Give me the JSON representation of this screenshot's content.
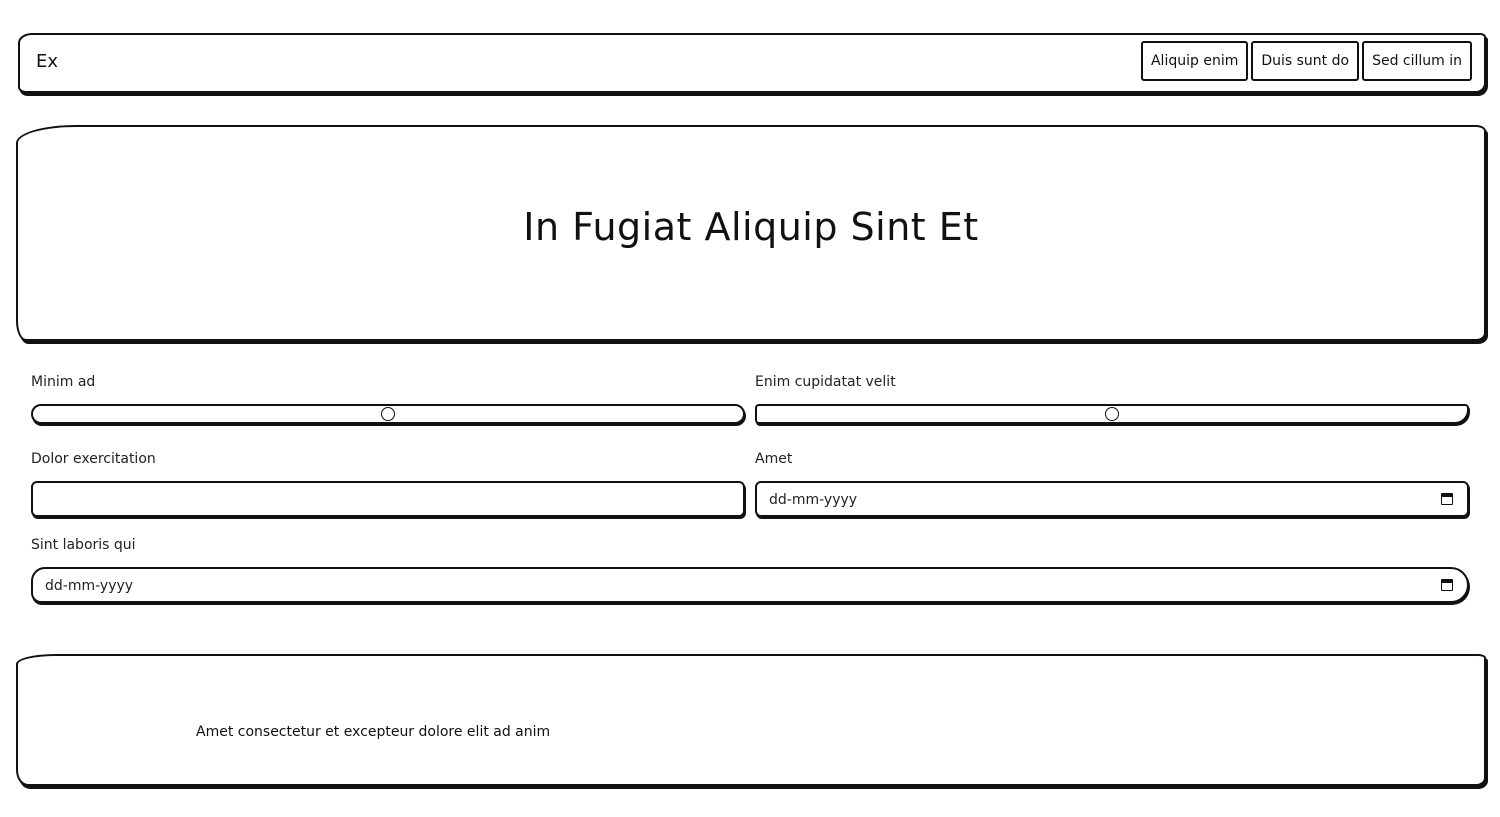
{
  "navbar": {
    "brand": "Ex",
    "links": [
      "Aliquip enim",
      "Duis sunt do",
      "Sed cillum in"
    ]
  },
  "hero": {
    "title": "In Fugiat Aliquip Sint Et"
  },
  "form": {
    "range1": {
      "label": "Minim ad",
      "value_fraction": 0.5
    },
    "range2": {
      "label": "Enim cupidatat velit",
      "value_fraction": 0.5
    },
    "text1": {
      "label": "Dolor exercitation",
      "value": ""
    },
    "date1": {
      "label": "Amet",
      "placeholder": "dd-mm-yyyy"
    },
    "date2": {
      "label": "Sint laboris qui",
      "placeholder": "dd-mm-yyyy"
    }
  },
  "footer": {
    "text": "Amet consectetur et excepteur dolore elit ad anim"
  }
}
